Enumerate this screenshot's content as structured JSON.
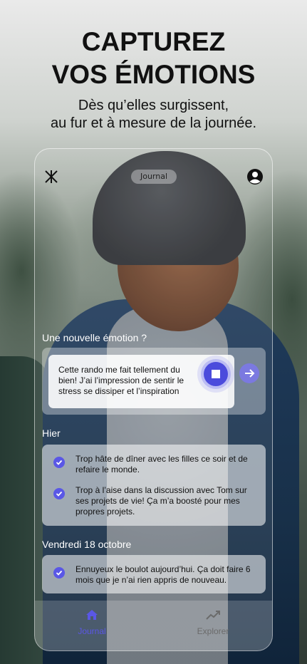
{
  "headline": {
    "line1": "CAPTUREZ",
    "line2": "VOS ÉMOTIONS"
  },
  "subhead": {
    "line1": "Dès qu’elles surgissent,",
    "line2": "au fur et à mesure de la journée."
  },
  "app": {
    "top_bar": {
      "logo_icon": "asterisk-logo-icon",
      "title": "Journal",
      "profile_icon": "account-circle-icon"
    },
    "new_emotion": {
      "label": "Une nouvelle émotion ?",
      "input_value": "Cette rando me fait tellement du bien! J’ai l’impression de sentir le stress se dissiper et l’inspiration",
      "stop_icon": "stop-square-icon",
      "send_icon": "arrow-right-icon"
    },
    "sections": [
      {
        "label": "Hier",
        "entries": [
          {
            "text": "Trop hâte de dîner avec les filles ce soir et de refaire le monde."
          },
          {
            "text": "Trop à l’aise dans la discussion avec Tom sur ses projets de vie! Ça m’a boosté pour mes propres projets."
          }
        ]
      },
      {
        "label": "Vendredi 18 octobre",
        "entries": [
          {
            "text": "Ennuyeux le boulot aujourd’hui. Ça doit faire 6 mois que je n’ai rien appris de nouveau."
          }
        ]
      }
    ],
    "bottom_nav": [
      {
        "label": "Journal",
        "icon": "home-icon",
        "active": true
      },
      {
        "label": "Explorer",
        "icon": "trend-icon",
        "active": false
      }
    ]
  },
  "colors": {
    "accent": "#5a57e6",
    "accent_soft": "#7b79e0",
    "text_dark": "#111111",
    "nav_inactive": "#6b6b6b"
  }
}
